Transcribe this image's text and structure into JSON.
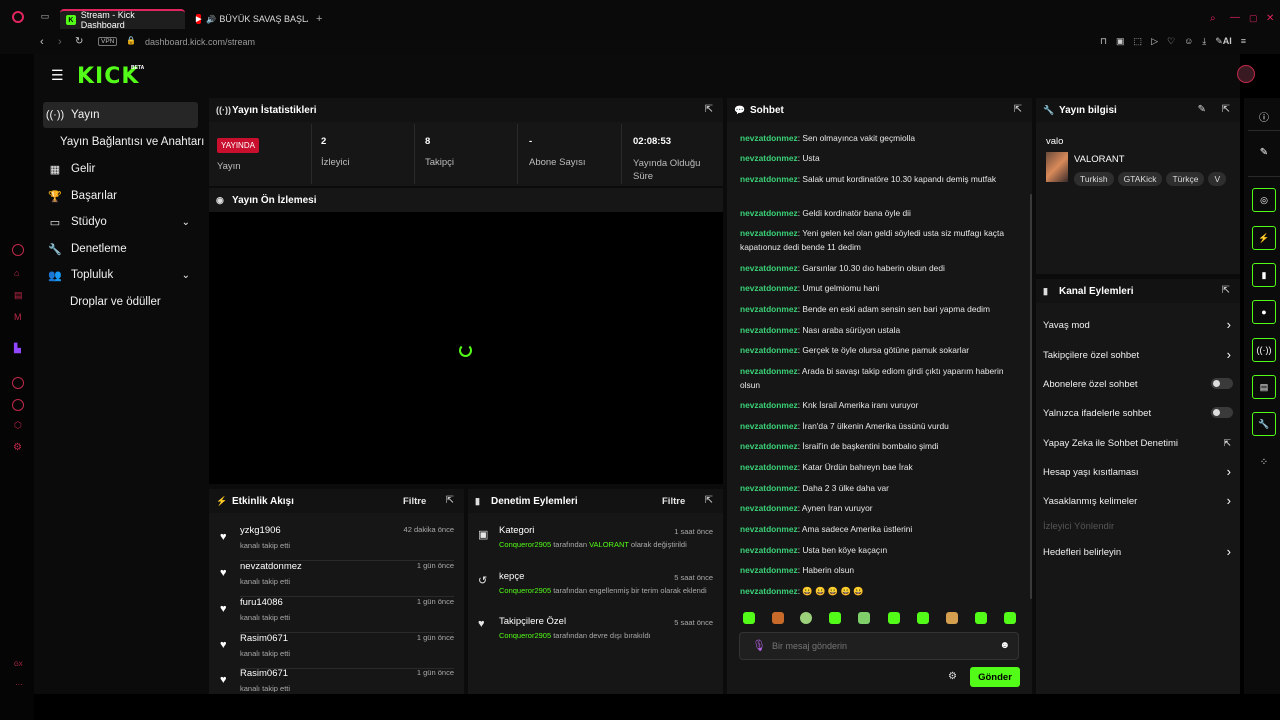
{
  "browser": {
    "tabs": [
      {
        "label": "Stream - Kick Dashboard",
        "active": true
      },
      {
        "label": "BÜYÜK SAVAŞ BAŞLAD",
        "active": false
      }
    ],
    "vpn_label": "VPN",
    "url": "dashboard.kick.com/stream",
    "ai_label": "AI",
    "opera_bottom_label": "GX"
  },
  "brand": {
    "logo": "KICK",
    "badge": "BETA",
    "accent": "#53fc18"
  },
  "sidebar": {
    "items": [
      {
        "label": "Yayın",
        "icon": "broadcast-icon",
        "active": true
      },
      {
        "label": "Yayın Bağlantısı ve Anahtarı",
        "icon": "",
        "active": false
      },
      {
        "label": "Gelir",
        "icon": "revenue-icon",
        "active": false
      },
      {
        "label": "Başarılar",
        "icon": "trophy-icon",
        "active": false
      },
      {
        "label": "Stüdyo",
        "icon": "studio-icon",
        "active": false
      },
      {
        "label": "Denetleme",
        "icon": "wrench-icon",
        "active": false
      },
      {
        "label": "Topluluk",
        "icon": "community-icon",
        "active": false
      },
      {
        "label": "Droplar ve ödüller",
        "icon": "",
        "active": false
      }
    ]
  },
  "stats": {
    "title": "Yayın İstatistikleri",
    "live_badge": "YAYINDA",
    "live_label": "Yayın",
    "viewers_value": "2",
    "viewers_label": "İzleyici",
    "followers_value": "8",
    "followers_label": "Takipçi",
    "subs_value": "-",
    "subs_label": "Abone Sayısı",
    "uptime_value": "02:08:53",
    "uptime_label": "Yayında Olduğu Süre"
  },
  "preview": {
    "title": "Yayın Ön İzlemesi"
  },
  "activity": {
    "title": "Etkinlik Akışı",
    "filter": "Filtre",
    "items": [
      {
        "name": "yzkg1906",
        "sub": "kanalı takip etti",
        "time": "42 dakika önce"
      },
      {
        "name": "nevzatdonmez",
        "sub": "kanalı takip etti",
        "time": "1 gün önce"
      },
      {
        "name": "furu14086",
        "sub": "kanalı takip etti",
        "time": "1 gün önce"
      },
      {
        "name": "Rasim0671",
        "sub": "kanalı takip etti",
        "time": "1 gün önce"
      },
      {
        "name": "Rasim0671",
        "sub": "kanalı takip etti",
        "time": "1 gün önce"
      }
    ]
  },
  "moderation": {
    "title": "Denetim Eylemleri",
    "filter": "Filtre",
    "items": [
      {
        "title": "Kategori",
        "time": "1 saat önce",
        "actor": "Conqueror2905",
        "mid": " tarafından ",
        "target": "VALORANT",
        "rest": " olarak değiştirildi"
      },
      {
        "title": "kepçe",
        "time": "5 saat önce",
        "actor": "Conqueror2905",
        "mid": " tarafından engellenmiş bir terim olarak eklendi",
        "target": "",
        "rest": ""
      },
      {
        "title": "Takipçilere Özel",
        "time": "5 saat önce",
        "actor": "Conqueror2905",
        "mid": " tarafından devre dışı bırakıldı",
        "target": "",
        "rest": ""
      }
    ]
  },
  "chat": {
    "title": "Sohbet",
    "messages": [
      {
        "user": "nevzatdonmez",
        "text": "Sen olmayınca vakit geçmiolla"
      },
      {
        "user": "nevzatdonmez",
        "text": "Usta"
      },
      {
        "user": "nevzatdonmez",
        "text": "Salak umut kordinatöre 10.30 kapandı demiş mutfak"
      },
      {
        "user": "nevzatdonmez",
        "text": "Geldi kordinatör bana öyle dii"
      },
      {
        "user": "nevzatdonmez",
        "text": "Yeni gelen kel olan geldi söyledi usta siz mutfagı kaçta kapatıonuz dedi bende 11 dedim"
      },
      {
        "user": "nevzatdonmez",
        "text": "Garsınlar 10.30 dıo haberin olsun dedi"
      },
      {
        "user": "nevzatdonmez",
        "text": "Umut gelmiomu hani"
      },
      {
        "user": "nevzatdonmez",
        "text": "Bende en eski adam sensin sen bari yapma dedim"
      },
      {
        "user": "nevzatdonmez",
        "text": "Nası araba sürüyon ustala"
      },
      {
        "user": "nevzatdonmez",
        "text": "Gerçek te öyle olursa götüne pamuk sokarlar"
      },
      {
        "user": "nevzatdonmez",
        "text": "Arada bi savaşı takip ediom girdi çıktı yaparım haberin olsun"
      },
      {
        "user": "nevzatdonmez",
        "text": "Knk İsrail Amerika iranı vuruyor"
      },
      {
        "user": "nevzatdonmez",
        "text": "İran'da 7 ülkenin Amerika üssünü vurdu"
      },
      {
        "user": "nevzatdonmez",
        "text": "İsrail'in de başkentini bombalıo şimdi"
      },
      {
        "user": "nevzatdonmez",
        "text": "Katar Ürdün bahreyn bae İrak"
      },
      {
        "user": "nevzatdonmez",
        "text": "Daha 2 3 ülke daha var"
      },
      {
        "user": "nevzatdonmez",
        "text": "Aynen İran vuruyor"
      },
      {
        "user": "nevzatdonmez",
        "text": "Ama sadece Amerika üstlerini"
      },
      {
        "user": "nevzatdonmez",
        "text": "Usta ben köye kaçaçın"
      },
      {
        "user": "nevzatdonmez",
        "text": "Haberin olsun"
      },
      {
        "user": "nevzatdonmez",
        "text": "😀 😀 😀 😀 😀"
      }
    ],
    "placeholder": "Bir mesaj gönderin",
    "send_label": "Gönder"
  },
  "stream_info": {
    "title": "Yayın bilgisi",
    "stream_title": "valo",
    "category": "VALORANT",
    "tags": [
      "Turkish",
      "GTAKick",
      "Türkçe",
      "V"
    ]
  },
  "channel_actions": {
    "title": "Kanal Eylemleri",
    "items": [
      {
        "label": "Yavaş mod",
        "control": "chevron"
      },
      {
        "label": "Takipçilere özel sohbet",
        "control": "chevron"
      },
      {
        "label": "Abonelere özel sohbet",
        "control": "toggle"
      },
      {
        "label": "Yalnızca ifadelerle sohbet",
        "control": "toggle"
      },
      {
        "label": "Yapay Zeka ile Sohbet Denetimi",
        "control": "external"
      },
      {
        "label": "Hesap yaşı kısıtlaması",
        "control": "chevron"
      },
      {
        "label": "Yasaklanmış kelimeler",
        "control": "chevron"
      },
      {
        "label": "İzleyici Yönlendir",
        "control": "disabled"
      },
      {
        "label": "Hedefleri belirleyin",
        "control": "chevron"
      }
    ]
  }
}
